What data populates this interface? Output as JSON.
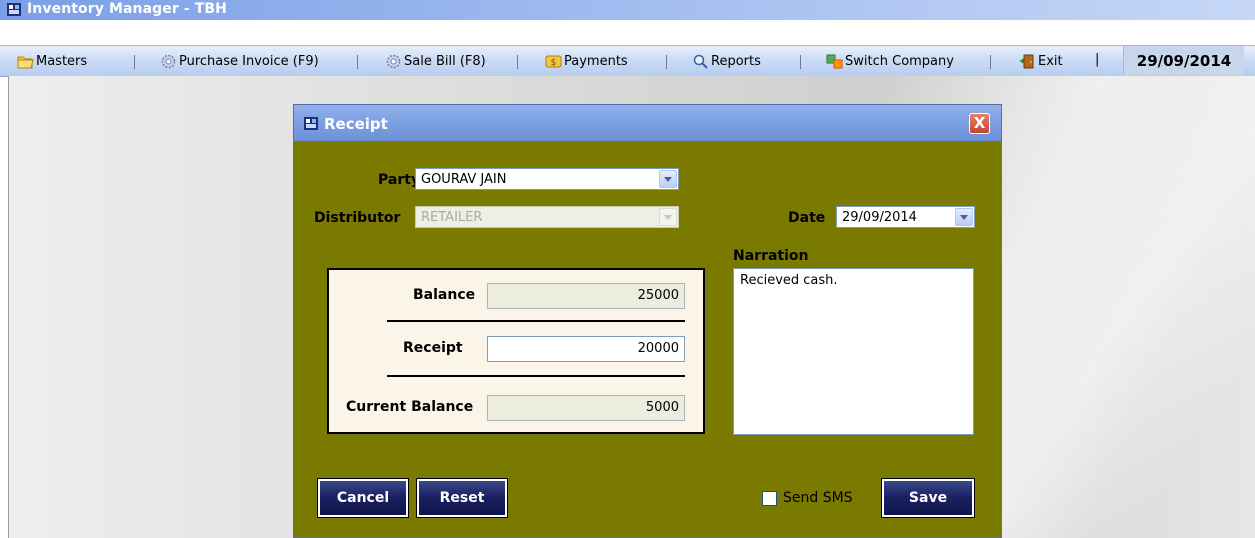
{
  "app": {
    "title": "Inventory Manager - TBH"
  },
  "menubar": {
    "items": [
      {
        "label": "Masters",
        "icon": "folder-icon"
      },
      {
        "label": "Purchase Invoice (F9)",
        "icon": "gear-icon"
      },
      {
        "label": "Sale Bill (F8)",
        "icon": "gear-icon"
      },
      {
        "label": "Payments",
        "icon": "money-icon"
      },
      {
        "label": "Reports",
        "icon": "magnifier-icon"
      },
      {
        "label": "Switch Company",
        "icon": "switch-icon"
      },
      {
        "label": "Exit",
        "icon": "door-icon"
      }
    ],
    "separator": "|",
    "date": "29/09/2014"
  },
  "dialog": {
    "title": "Receipt",
    "close_glyph": "X",
    "party": {
      "label": "Party",
      "value": "GOURAV JAIN"
    },
    "distributor": {
      "label": "Distributor",
      "value": "RETAILER"
    },
    "date": {
      "label": "Date",
      "value": "29/09/2014"
    },
    "balance": {
      "label": "Balance",
      "value": "25000"
    },
    "receipt": {
      "label": "Receipt",
      "value": "20000"
    },
    "current_balance": {
      "label": "Current Balance",
      "value": "5000"
    },
    "narration": {
      "label": "Narration",
      "value": "Recieved cash."
    },
    "cancel_label": "Cancel",
    "reset_label": "Reset",
    "send_sms_label": "Send SMS",
    "save_label": "Save"
  },
  "colors": {
    "dialog_bg": "#7a7a00",
    "button_bg": "#1b2263",
    "title_blue": "#7ea1e3"
  }
}
